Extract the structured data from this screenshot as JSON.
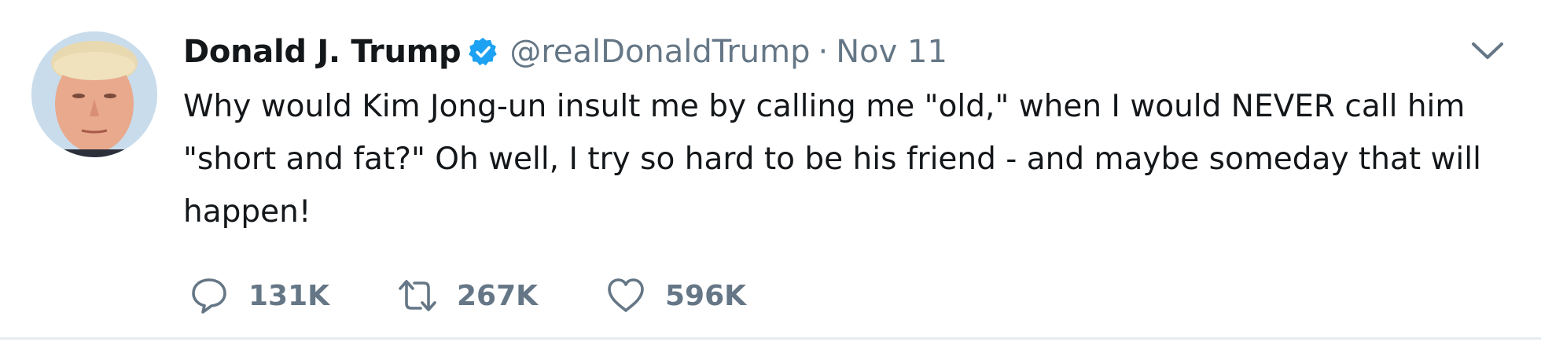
{
  "user": {
    "name": "Donald J. Trump",
    "handle": "@realDonaldTrump",
    "separator": "·",
    "timestamp": "Nov 11",
    "verified": true
  },
  "tweet": {
    "text": "Why would Kim Jong-un insult me by calling me \"old,\" when I would NEVER call him \"short and fat?\" Oh well, I try so hard to be his friend - and maybe someday that will happen!"
  },
  "actions": {
    "replies": "131K",
    "retweets": "267K",
    "likes": "596K"
  },
  "icons": {
    "reply": "reply-icon",
    "retweet": "retweet-icon",
    "like": "heart-icon",
    "more": "chevron-down-icon",
    "verified": "verified-badge-icon"
  },
  "colors": {
    "text": "#14171a",
    "secondary": "#657786",
    "verified": "#1da1f2",
    "divider": "#e6ecf0"
  }
}
